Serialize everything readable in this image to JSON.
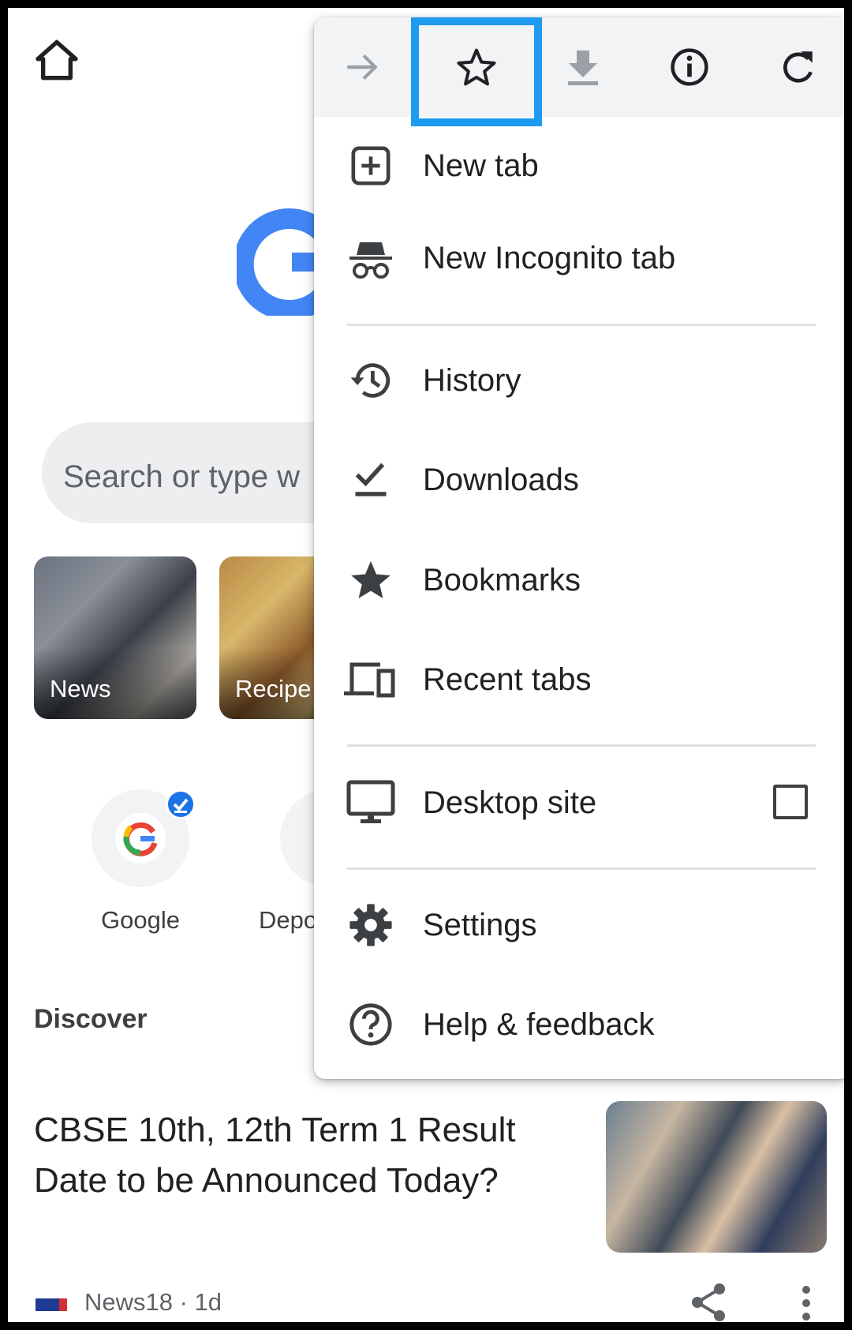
{
  "page": {
    "search_placeholder": "Search or type w",
    "tiles": [
      {
        "label": "News"
      },
      {
        "label": "Recipe"
      }
    ],
    "shortcuts": [
      {
        "label": "Google"
      },
      {
        "label": "Depo"
      }
    ],
    "discover_label": "Discover",
    "article": {
      "title": "CBSE 10th, 12th Term 1 Result Date to be Announced Today?",
      "source": "News18 · 1d"
    }
  },
  "menu": {
    "toolbar": [
      {
        "icon": "forward-arrow-icon"
      },
      {
        "icon": "star-outline-icon",
        "highlighted": true
      },
      {
        "icon": "download-icon"
      },
      {
        "icon": "info-icon"
      },
      {
        "icon": "reload-icon"
      }
    ],
    "items": [
      {
        "label": "New tab",
        "icon": "add-box-icon"
      },
      {
        "label": "New Incognito tab",
        "icon": "incognito-icon"
      },
      {
        "label": "History",
        "icon": "history-icon"
      },
      {
        "label": "Downloads",
        "icon": "download-done-icon"
      },
      {
        "label": "Bookmarks",
        "icon": "star-filled-icon"
      },
      {
        "label": "Recent tabs",
        "icon": "devices-icon"
      },
      {
        "label": "Desktop site",
        "icon": "desktop-icon",
        "checked": false
      },
      {
        "label": "Settings",
        "icon": "gear-icon"
      },
      {
        "label": "Help & feedback",
        "icon": "help-icon"
      }
    ]
  },
  "colors": {
    "highlight": "#1e9bf0",
    "google_blue": "#4285f4",
    "toolbar_bg": "#f1f3f4"
  }
}
